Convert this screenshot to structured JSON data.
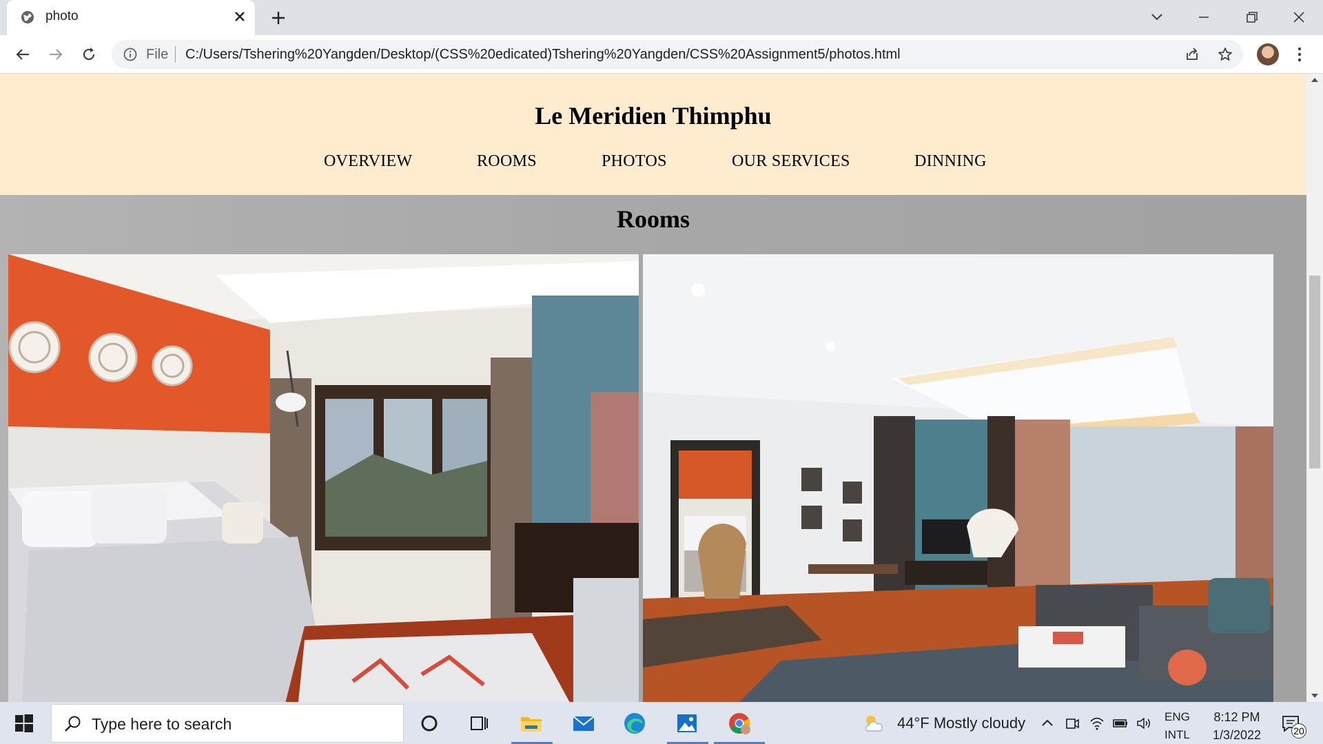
{
  "browser": {
    "tab_title": "photo",
    "address_scheme_label": "File",
    "url": "C:/Users/Tshering%20Yangden/Desktop/(CSS%20edicated)Tshering%20Yangden/CSS%20Assignment5/photos.html"
  },
  "site": {
    "title": "Le Meridien Thimphu",
    "nav": [
      "OVERVIEW",
      "ROOMS",
      "PHOTOS",
      "OUR SERVICES",
      "DINNING"
    ],
    "section_title": "Rooms",
    "photos": [
      {
        "alt": "bedroom-photo"
      },
      {
        "alt": "living-room-photo"
      }
    ],
    "colors": {
      "header_bg": "#ffebcd",
      "gallery_bg": "#a9a9a9"
    }
  },
  "taskbar": {
    "search_placeholder": "Type here to search",
    "weather": "44°F  Mostly cloudy",
    "lang_top": "ENG",
    "lang_bottom": "INTL",
    "time": "8:12 PM",
    "date": "1/3/2022",
    "notification_count": "20"
  }
}
